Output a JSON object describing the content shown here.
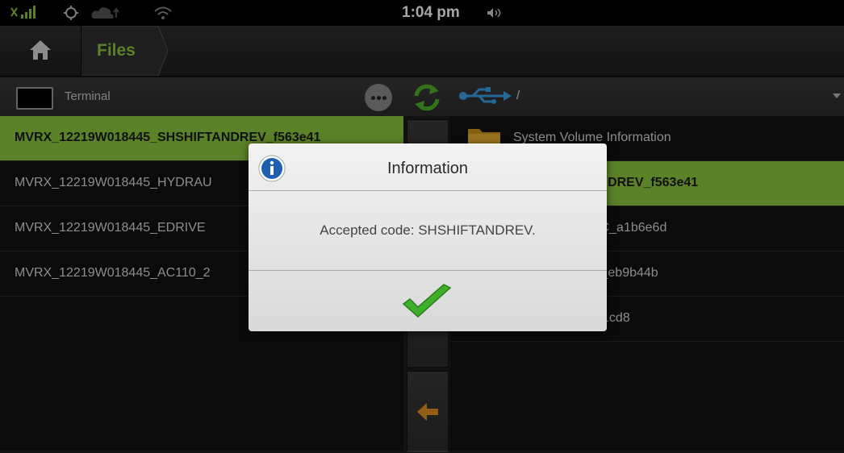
{
  "status": {
    "time": "1:04 pm"
  },
  "nav": {
    "home_icon": "home-icon",
    "crumb": "Files"
  },
  "left_panel": {
    "title": "Terminal",
    "items": [
      "MVRX_12219W018445_SHSHIFTANDREV_f563e41",
      "MVRX_12219W018445_HYDRAU",
      "MVRX_12219W018445_EDRIVE",
      "MVRX_12219W018445_AC110_2"
    ],
    "selected_index": 0
  },
  "right_panel": {
    "path": "/",
    "items": [
      "System Volume Information",
      "45_SHSHIFTANDREV_f563e41",
      "45_HYDRAULIC_a1b6e6d",
      "45_EDRIVEM1_eb9b44b",
      "45_AC110_2021cd8"
    ],
    "selected_index": 1
  },
  "dialog": {
    "title": "Information",
    "message": "Accepted code: SHSHIFTANDREV.",
    "ok_icon": "checkmark-icon"
  },
  "colors": {
    "accent": "#8cc63f",
    "selected_text": "#1a1a1a"
  }
}
